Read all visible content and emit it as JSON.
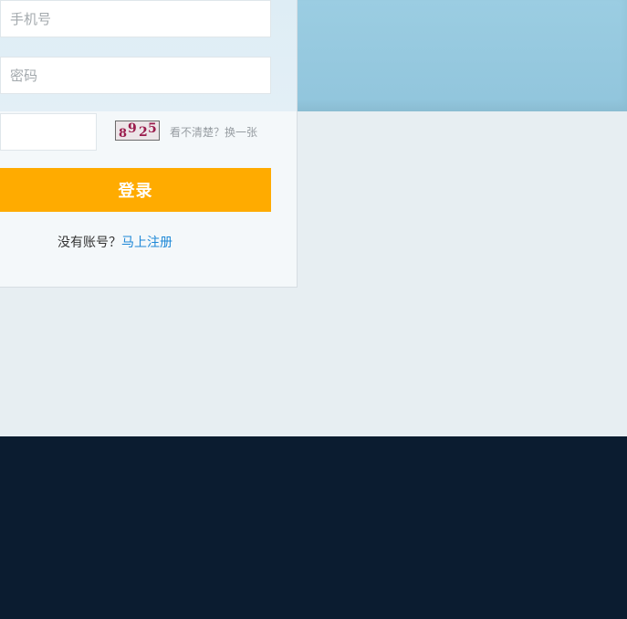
{
  "login": {
    "phone_placeholder": "手机号",
    "password_placeholder": "密码",
    "captcha_placeholder": "",
    "captcha_chars": [
      "8",
      "9",
      "2",
      "5"
    ],
    "refresh_text": "看不清楚？换一张",
    "submit_label": "登录",
    "no_account_text": "没有账号？",
    "register_link": "马上注册"
  },
  "colors": {
    "accent": "#ffab00",
    "link": "#1e88d7",
    "sky": "#99cbe0",
    "footer": "#0b1c30"
  }
}
